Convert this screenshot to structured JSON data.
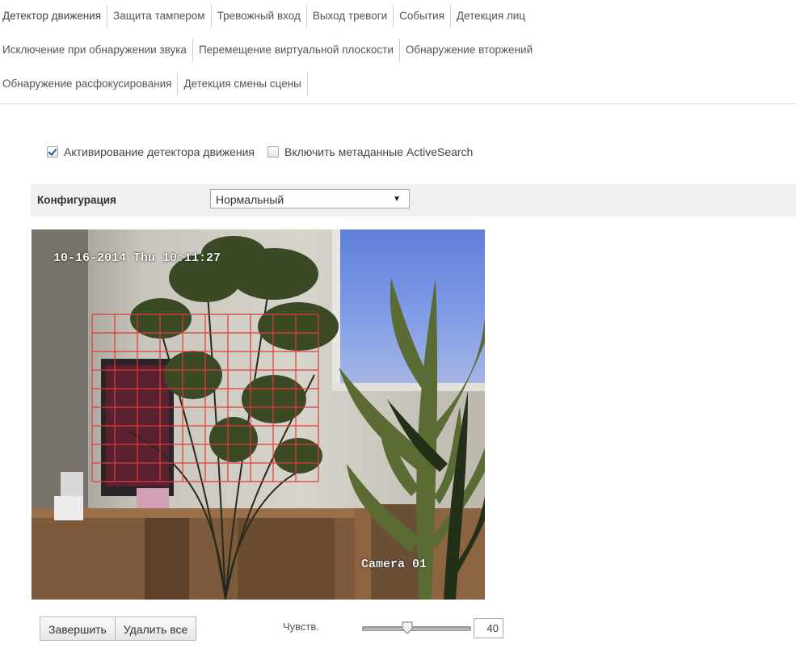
{
  "tabs": {
    "row1": [
      "Детектор движения",
      "Защита тампером",
      "Тревожный вход",
      "Выход тревоги",
      "События",
      "Детекция лиц"
    ],
    "row2": [
      "Исключение при обнаружении звука",
      "Перемещение виртуальной плоскости",
      "Обнаружение вторжений"
    ],
    "row3": [
      "Обнаружение расфокусирования",
      "Детекция смены сцены"
    ]
  },
  "options": {
    "enable_motion_label": "Активирование детектора движения",
    "enable_motion_checked": true,
    "metadata_label": "Включить метаданные ActiveSearch",
    "metadata_checked": false
  },
  "config": {
    "label": "Конфигурация",
    "selected": "Нормальный"
  },
  "video": {
    "timestamp": "10-16-2014 Thu 10:11:27",
    "camera_label": "Camera 01",
    "grid_color": "#e23b3b"
  },
  "actions": {
    "finish_label": "Завершить",
    "delete_all_label": "Удалить все"
  },
  "sensitivity": {
    "label": "Чувств.",
    "value": "40",
    "fraction": 0.4
  }
}
